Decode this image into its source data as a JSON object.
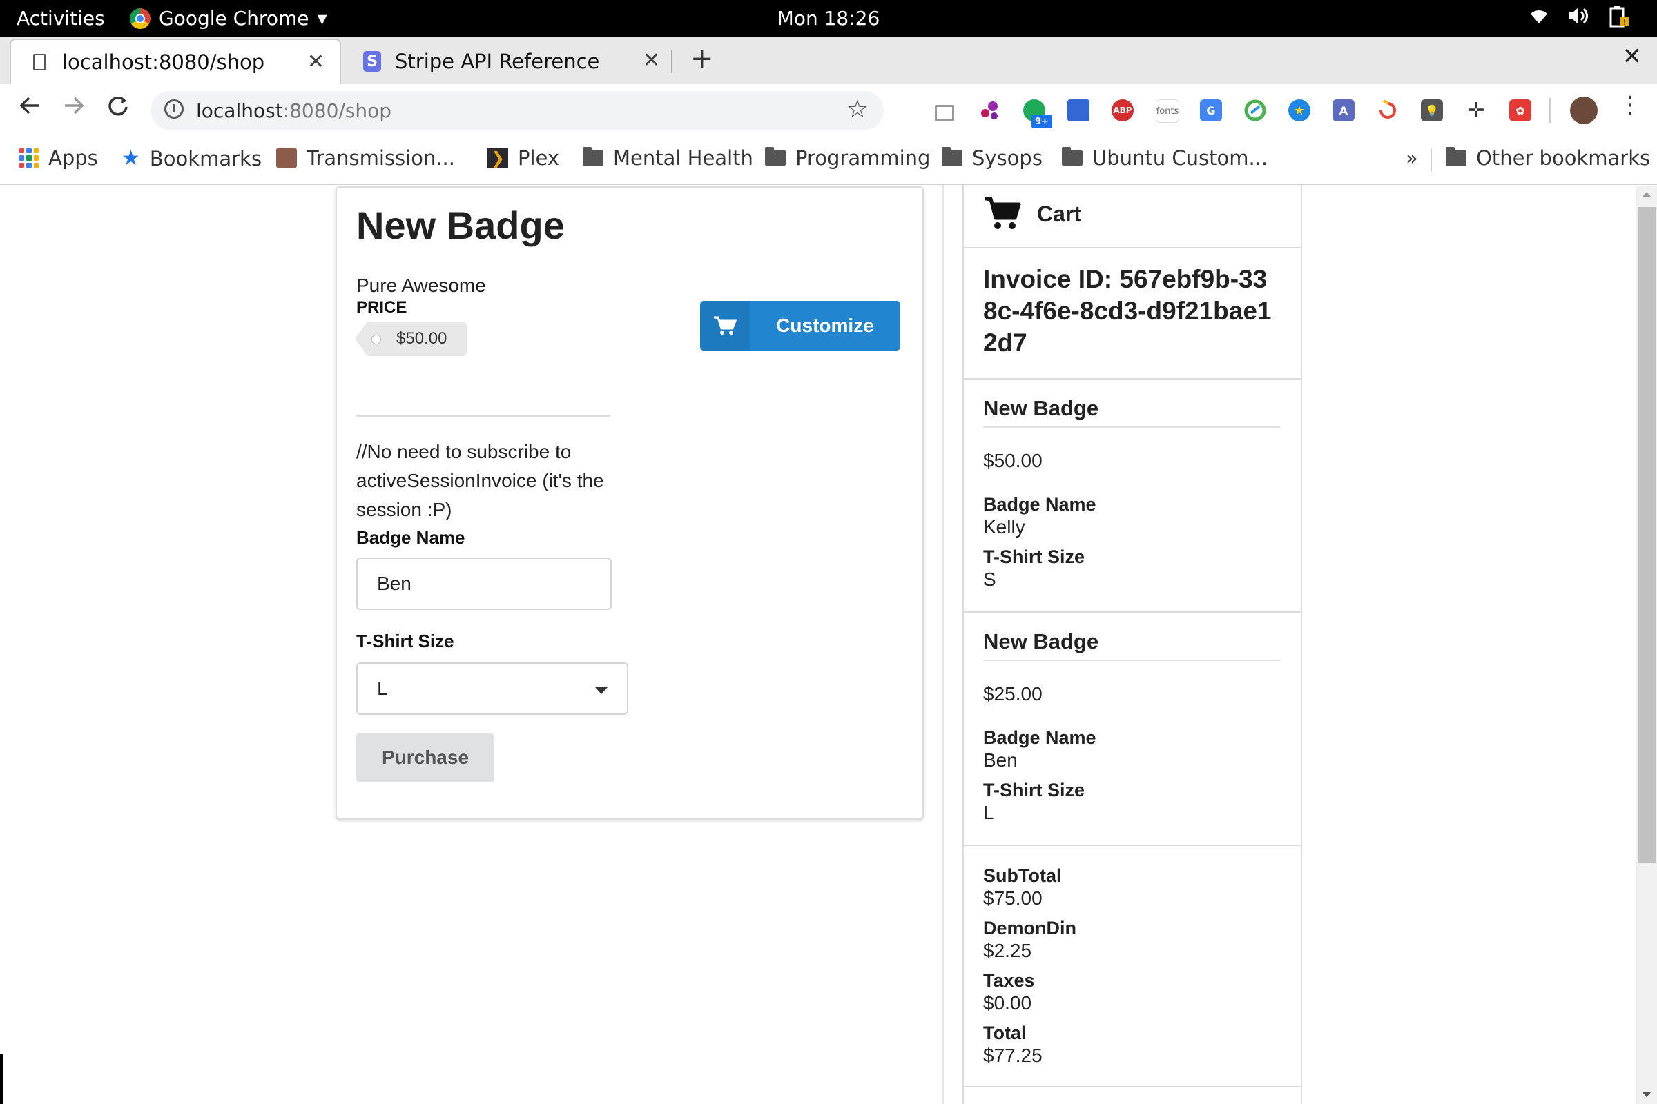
{
  "os": {
    "activities": "Activities",
    "app_menu": "Google Chrome",
    "clock": "Mon 18:26"
  },
  "tabs": [
    {
      "title": "localhost:8080/shop",
      "active": true,
      "icon": "document-icon"
    },
    {
      "title": "Stripe API Reference",
      "active": false,
      "icon": "stripe-icon"
    }
  ],
  "toolbar": {
    "url_host": "localhost",
    "url_path": ":8080/shop"
  },
  "bookmarks": {
    "items": [
      "Apps",
      "Bookmarks",
      "Transmission...",
      "Plex",
      "Mental Health",
      "Programming",
      "Sysops",
      "Ubuntu Custom..."
    ],
    "overflow": "»",
    "other": "Other bookmarks"
  },
  "product": {
    "title": "New Badge",
    "description": "Pure Awesome",
    "price_label": "PRICE",
    "price": "$50.00",
    "customize_label": "Customize",
    "comment": "//No need to subscribe to activeSessionInvoice (it's the session :P)",
    "badge_name_label": "Badge Name",
    "badge_name_value": "Ben",
    "tshirt_label": "T-Shirt Size",
    "tshirt_value": "L",
    "purchase_label": "Purchase"
  },
  "cart": {
    "title": "Cart",
    "invoice": "Invoice ID: 567ebf9b-338c-4f6e-8cd3-d9f21bae12d7",
    "items": [
      {
        "name": "New Badge",
        "price": "$50.00",
        "badge_name_label": "Badge Name",
        "badge_name": "Kelly",
        "tshirt_label": "T-Shirt Size",
        "tshirt": "S"
      },
      {
        "name": "New Badge",
        "price": "$25.00",
        "badge_name_label": "Badge Name",
        "badge_name": "Ben",
        "tshirt_label": "T-Shirt Size",
        "tshirt": "L"
      }
    ],
    "totals": {
      "subtotal_label": "SubTotal",
      "subtotal": "$75.00",
      "fee_label": "DemonDin",
      "fee": "$2.25",
      "taxes_label": "Taxes",
      "taxes": "$0.00",
      "total_label": "Total",
      "total": "$77.25"
    }
  },
  "colors": {
    "primary_button": "#2185d0",
    "disabled_button": "#e0e1e2"
  }
}
